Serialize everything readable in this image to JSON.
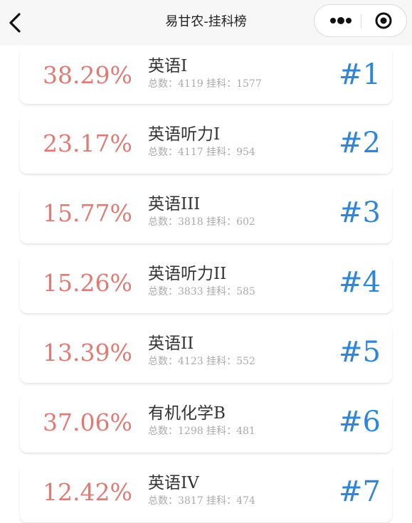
{
  "navbar": {
    "title": "易甘农-挂科榜",
    "back_icon": "chevron-left-icon",
    "more_icon": "more-dots-icon",
    "close_icon": "target-close-icon"
  },
  "stats_labels": {
    "total": "总数：",
    "failed": "挂科："
  },
  "items": [
    {
      "rate": "38.29%",
      "course": "英语I",
      "total": "4119",
      "failed": "1577",
      "rank": "#1"
    },
    {
      "rate": "23.17%",
      "course": "英语听力I",
      "total": "4117",
      "failed": "954",
      "rank": "#2"
    },
    {
      "rate": "15.77%",
      "course": "英语III",
      "total": "3818",
      "failed": "602",
      "rank": "#3"
    },
    {
      "rate": "15.26%",
      "course": "英语听力II",
      "total": "3833",
      "failed": "585",
      "rank": "#4"
    },
    {
      "rate": "13.39%",
      "course": "英语II",
      "total": "4123",
      "failed": "552",
      "rank": "#5"
    },
    {
      "rate": "37.06%",
      "course": "有机化学B",
      "total": "1298",
      "failed": "481",
      "rank": "#6"
    },
    {
      "rate": "12.42%",
      "course": "英语IV",
      "total": "3817",
      "failed": "474",
      "rank": "#7"
    }
  ],
  "colors": {
    "rate": "#e07a74",
    "rank": "#2f86d6",
    "stats": "#aaaaaa"
  }
}
